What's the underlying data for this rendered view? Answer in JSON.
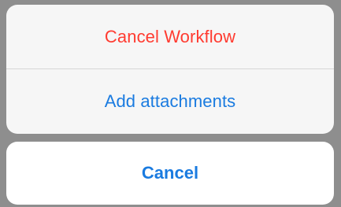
{
  "action_sheet": {
    "actions": [
      {
        "label": "Cancel Workflow",
        "style": "destructive",
        "color": "#ff3b30"
      },
      {
        "label": "Add attachments",
        "style": "default",
        "color": "#1a7be0"
      }
    ],
    "cancel": {
      "label": "Cancel",
      "color": "#1a7be0"
    }
  }
}
